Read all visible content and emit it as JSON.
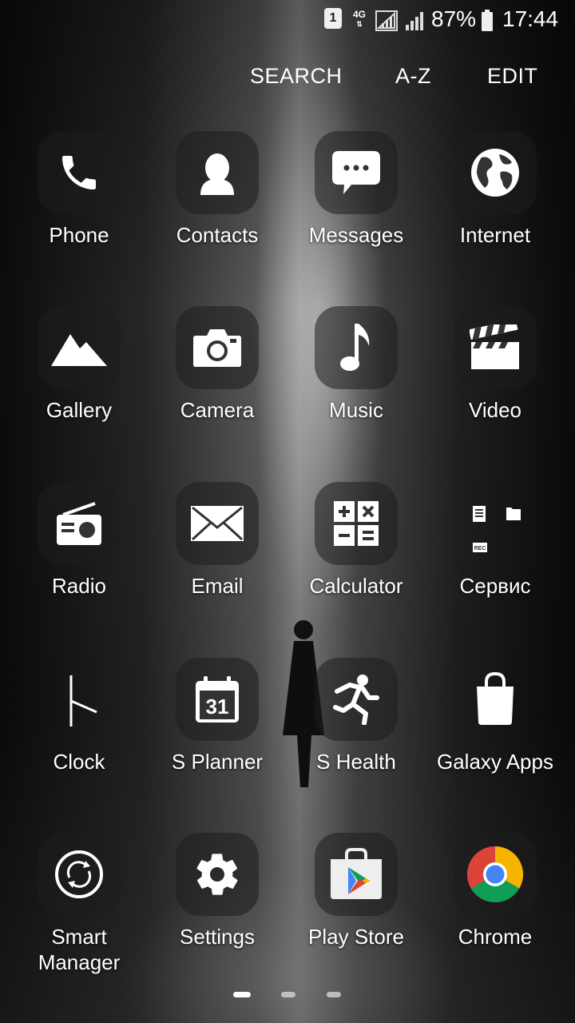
{
  "status_bar": {
    "sim_badge": "1",
    "network_type": "4G",
    "battery": "87%",
    "time": "17:44"
  },
  "top_actions": {
    "search": "SEARCH",
    "az": "A-Z",
    "edit": "EDIT"
  },
  "apps": [
    {
      "label": "Phone",
      "icon": "phone-icon"
    },
    {
      "label": "Contacts",
      "icon": "contacts-icon"
    },
    {
      "label": "Messages",
      "icon": "messages-icon"
    },
    {
      "label": "Internet",
      "icon": "globe-icon"
    },
    {
      "label": "Gallery",
      "icon": "gallery-icon"
    },
    {
      "label": "Camera",
      "icon": "camera-icon"
    },
    {
      "label": "Music",
      "icon": "music-note-icon"
    },
    {
      "label": "Video",
      "icon": "clapperboard-icon"
    },
    {
      "label": "Radio",
      "icon": "radio-icon"
    },
    {
      "label": "Email",
      "icon": "envelope-icon"
    },
    {
      "label": "Calculator",
      "icon": "calculator-icon"
    },
    {
      "label": "Сервис",
      "icon": "folder-icon"
    },
    {
      "label": "Clock",
      "icon": "clock-icon"
    },
    {
      "label": "S Planner",
      "icon": "calendar-icon",
      "calendar_day": "31"
    },
    {
      "label": "S Health",
      "icon": "running-person-icon"
    },
    {
      "label": "Galaxy Apps",
      "icon": "shopping-bag-icon"
    },
    {
      "label": "Smart Manager",
      "icon": "smart-manager-icon",
      "label_line1": "Smart",
      "label_line2": "Manager"
    },
    {
      "label": "Settings",
      "icon": "gear-icon"
    },
    {
      "label": "Play Store",
      "icon": "play-store-icon"
    },
    {
      "label": "Chrome",
      "icon": "chrome-icon"
    }
  ],
  "folder_badge": "REC",
  "page_indicator": {
    "total": 3,
    "current": 1
  },
  "colors": {
    "text": "#ffffff",
    "chrome_red": "#db4437",
    "chrome_yellow": "#f4b400",
    "chrome_green": "#0f9d58",
    "chrome_blue": "#4285f4"
  }
}
